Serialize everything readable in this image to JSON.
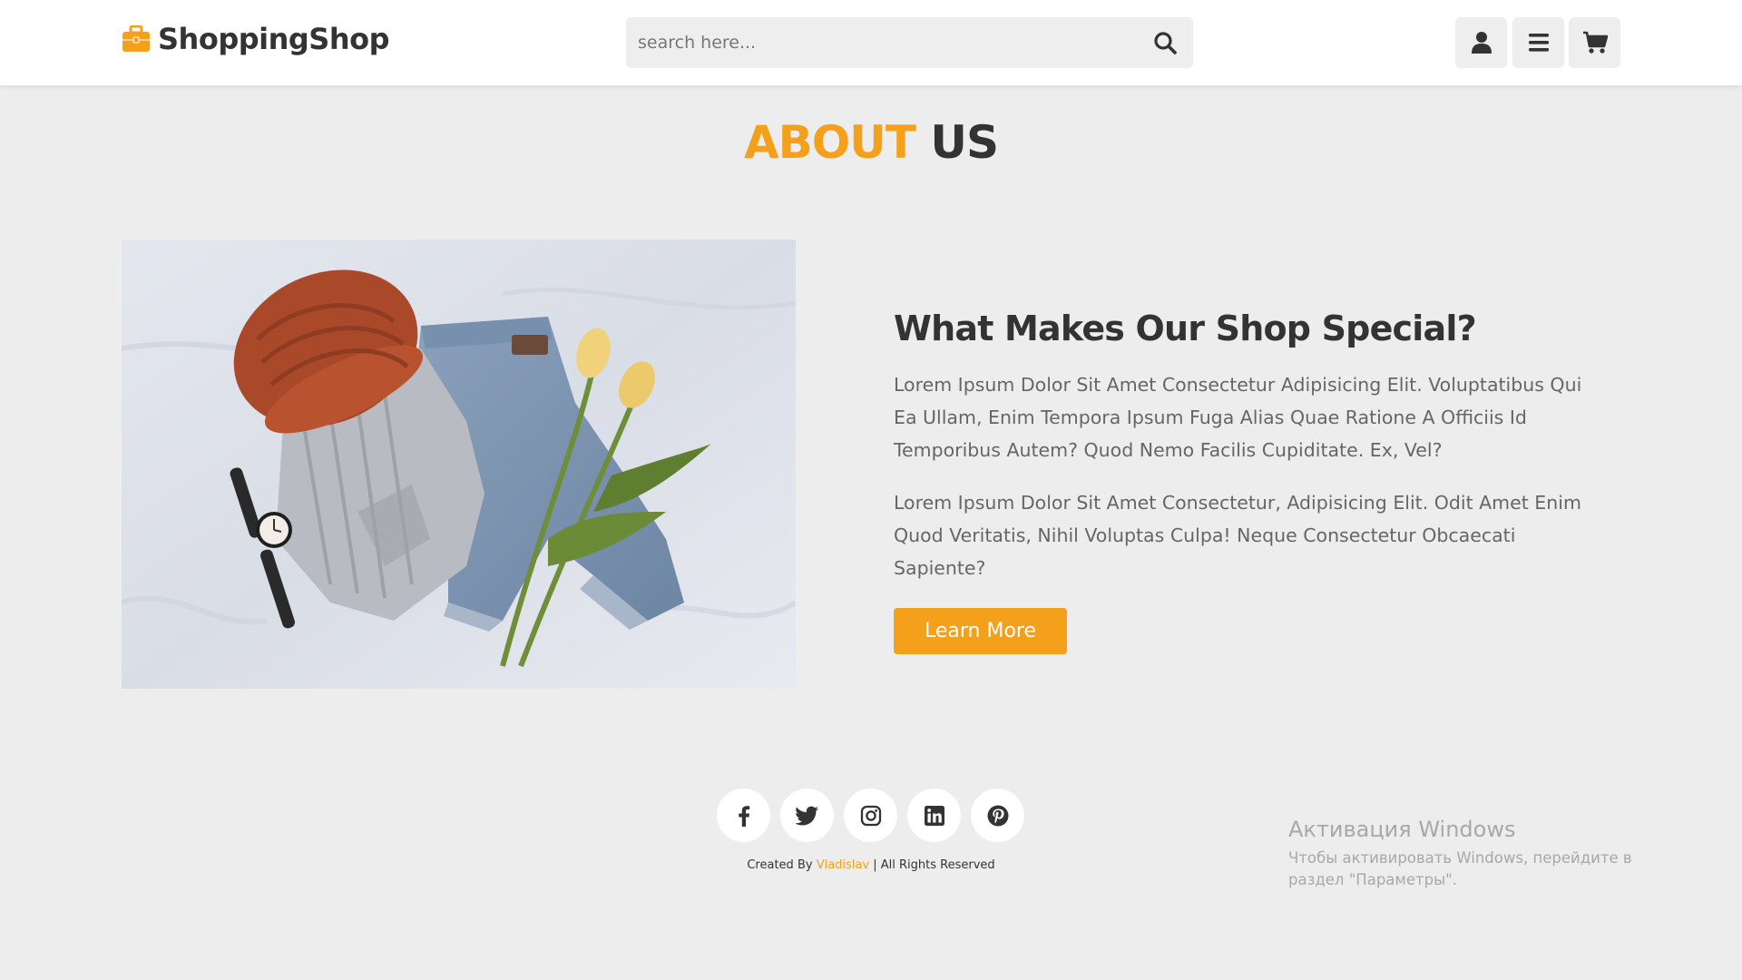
{
  "header": {
    "logo_text": "ShoppingShop",
    "search": {
      "placeholder": "search here..."
    },
    "icons": [
      "user-icon",
      "menu-icon",
      "cart-icon"
    ]
  },
  "about": {
    "heading_accent": "ABOUT",
    "heading_rest": "US",
    "title": "What Makes Our Shop Special?",
    "paragraph_1": "Lorem Ipsum Dolor Sit Amet Consectetur Adipisicing Elit. Voluptatibus Qui Ea Ullam, Enim Tempora Ipsum Fuga Alias Quae Ratione A Officiis Id Temporibus Autem? Quod Nemo Facilis Cupiditate. Ex, Vel?",
    "paragraph_2": "Lorem Ipsum Dolor Sit Amet Consectetur, Adipisicing Elit. Odit Amet Enim Quod Veritatis, Nihil Voluptas Culpa! Neque Consectetur Obcaecati Sapiente?",
    "button_label": "Learn More"
  },
  "footer": {
    "socials": [
      "facebook-icon",
      "twitter-icon",
      "instagram-icon",
      "linkedin-icon",
      "pinterest-icon"
    ],
    "credit_prefix": "Created By",
    "credit_author": "Vladislav",
    "credit_suffix": "| All Rights Reserved"
  },
  "watermark": {
    "title": "Активация Windows",
    "text": "Чтобы активировать Windows, перейдите в раздел \"Параметры\"."
  },
  "colors": {
    "accent": "#f5a01a",
    "dark_text": "#333333",
    "body_text": "#666666",
    "background": "#ededed"
  }
}
